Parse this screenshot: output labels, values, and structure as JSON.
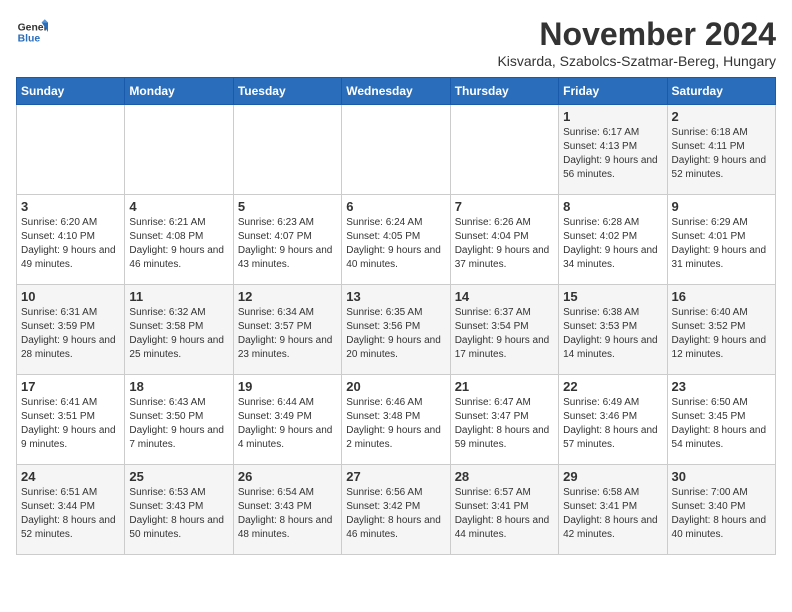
{
  "logo": {
    "general": "General",
    "blue": "Blue"
  },
  "title": "November 2024",
  "location": "Kisvarda, Szabolcs-Szatmar-Bereg, Hungary",
  "days_of_week": [
    "Sunday",
    "Monday",
    "Tuesday",
    "Wednesday",
    "Thursday",
    "Friday",
    "Saturday"
  ],
  "weeks": [
    [
      {
        "day": "",
        "info": ""
      },
      {
        "day": "",
        "info": ""
      },
      {
        "day": "",
        "info": ""
      },
      {
        "day": "",
        "info": ""
      },
      {
        "day": "",
        "info": ""
      },
      {
        "day": "1",
        "info": "Sunrise: 6:17 AM\nSunset: 4:13 PM\nDaylight: 9 hours and 56 minutes."
      },
      {
        "day": "2",
        "info": "Sunrise: 6:18 AM\nSunset: 4:11 PM\nDaylight: 9 hours and 52 minutes."
      }
    ],
    [
      {
        "day": "3",
        "info": "Sunrise: 6:20 AM\nSunset: 4:10 PM\nDaylight: 9 hours and 49 minutes."
      },
      {
        "day": "4",
        "info": "Sunrise: 6:21 AM\nSunset: 4:08 PM\nDaylight: 9 hours and 46 minutes."
      },
      {
        "day": "5",
        "info": "Sunrise: 6:23 AM\nSunset: 4:07 PM\nDaylight: 9 hours and 43 minutes."
      },
      {
        "day": "6",
        "info": "Sunrise: 6:24 AM\nSunset: 4:05 PM\nDaylight: 9 hours and 40 minutes."
      },
      {
        "day": "7",
        "info": "Sunrise: 6:26 AM\nSunset: 4:04 PM\nDaylight: 9 hours and 37 minutes."
      },
      {
        "day": "8",
        "info": "Sunrise: 6:28 AM\nSunset: 4:02 PM\nDaylight: 9 hours and 34 minutes."
      },
      {
        "day": "9",
        "info": "Sunrise: 6:29 AM\nSunset: 4:01 PM\nDaylight: 9 hours and 31 minutes."
      }
    ],
    [
      {
        "day": "10",
        "info": "Sunrise: 6:31 AM\nSunset: 3:59 PM\nDaylight: 9 hours and 28 minutes."
      },
      {
        "day": "11",
        "info": "Sunrise: 6:32 AM\nSunset: 3:58 PM\nDaylight: 9 hours and 25 minutes."
      },
      {
        "day": "12",
        "info": "Sunrise: 6:34 AM\nSunset: 3:57 PM\nDaylight: 9 hours and 23 minutes."
      },
      {
        "day": "13",
        "info": "Sunrise: 6:35 AM\nSunset: 3:56 PM\nDaylight: 9 hours and 20 minutes."
      },
      {
        "day": "14",
        "info": "Sunrise: 6:37 AM\nSunset: 3:54 PM\nDaylight: 9 hours and 17 minutes."
      },
      {
        "day": "15",
        "info": "Sunrise: 6:38 AM\nSunset: 3:53 PM\nDaylight: 9 hours and 14 minutes."
      },
      {
        "day": "16",
        "info": "Sunrise: 6:40 AM\nSunset: 3:52 PM\nDaylight: 9 hours and 12 minutes."
      }
    ],
    [
      {
        "day": "17",
        "info": "Sunrise: 6:41 AM\nSunset: 3:51 PM\nDaylight: 9 hours and 9 minutes."
      },
      {
        "day": "18",
        "info": "Sunrise: 6:43 AM\nSunset: 3:50 PM\nDaylight: 9 hours and 7 minutes."
      },
      {
        "day": "19",
        "info": "Sunrise: 6:44 AM\nSunset: 3:49 PM\nDaylight: 9 hours and 4 minutes."
      },
      {
        "day": "20",
        "info": "Sunrise: 6:46 AM\nSunset: 3:48 PM\nDaylight: 9 hours and 2 minutes."
      },
      {
        "day": "21",
        "info": "Sunrise: 6:47 AM\nSunset: 3:47 PM\nDaylight: 8 hours and 59 minutes."
      },
      {
        "day": "22",
        "info": "Sunrise: 6:49 AM\nSunset: 3:46 PM\nDaylight: 8 hours and 57 minutes."
      },
      {
        "day": "23",
        "info": "Sunrise: 6:50 AM\nSunset: 3:45 PM\nDaylight: 8 hours and 54 minutes."
      }
    ],
    [
      {
        "day": "24",
        "info": "Sunrise: 6:51 AM\nSunset: 3:44 PM\nDaylight: 8 hours and 52 minutes."
      },
      {
        "day": "25",
        "info": "Sunrise: 6:53 AM\nSunset: 3:43 PM\nDaylight: 8 hours and 50 minutes."
      },
      {
        "day": "26",
        "info": "Sunrise: 6:54 AM\nSunset: 3:43 PM\nDaylight: 8 hours and 48 minutes."
      },
      {
        "day": "27",
        "info": "Sunrise: 6:56 AM\nSunset: 3:42 PM\nDaylight: 8 hours and 46 minutes."
      },
      {
        "day": "28",
        "info": "Sunrise: 6:57 AM\nSunset: 3:41 PM\nDaylight: 8 hours and 44 minutes."
      },
      {
        "day": "29",
        "info": "Sunrise: 6:58 AM\nSunset: 3:41 PM\nDaylight: 8 hours and 42 minutes."
      },
      {
        "day": "30",
        "info": "Sunrise: 7:00 AM\nSunset: 3:40 PM\nDaylight: 8 hours and 40 minutes."
      }
    ]
  ]
}
